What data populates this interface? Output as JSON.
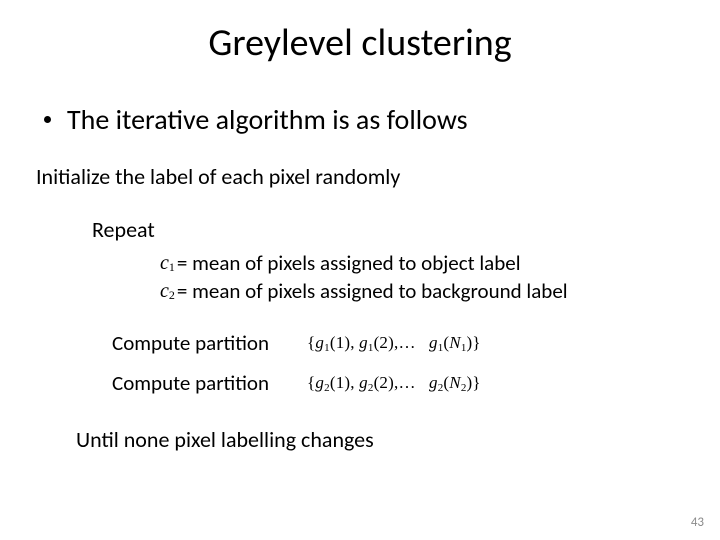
{
  "title": "Greylevel clustering",
  "bullet": "The iterative algorithm is as follows",
  "init": "Initialize the label of each pixel randomly",
  "repeat": "Repeat",
  "c1": {
    "sym": "c",
    "sub": "1",
    "text": "= mean of pixels assigned to object label"
  },
  "c2": {
    "sym": "c",
    "sub": "2",
    "text": "= mean of pixels assigned to background label"
  },
  "compute1": {
    "label": "Compute partition",
    "set": {
      "g": "g",
      "i": "1",
      "a": "(1),",
      "b": "(2),",
      "ell": "…",
      "n": "N",
      "ni": "1",
      "close": ")"
    }
  },
  "compute2": {
    "label": "Compute partition",
    "set": {
      "g": "g",
      "i": "2",
      "a": "(1),",
      "b": "(2),",
      "ell": "…",
      "n": "N",
      "ni": "2",
      "close": ")"
    }
  },
  "until": "Until none pixel labelling changes",
  "page": "43"
}
